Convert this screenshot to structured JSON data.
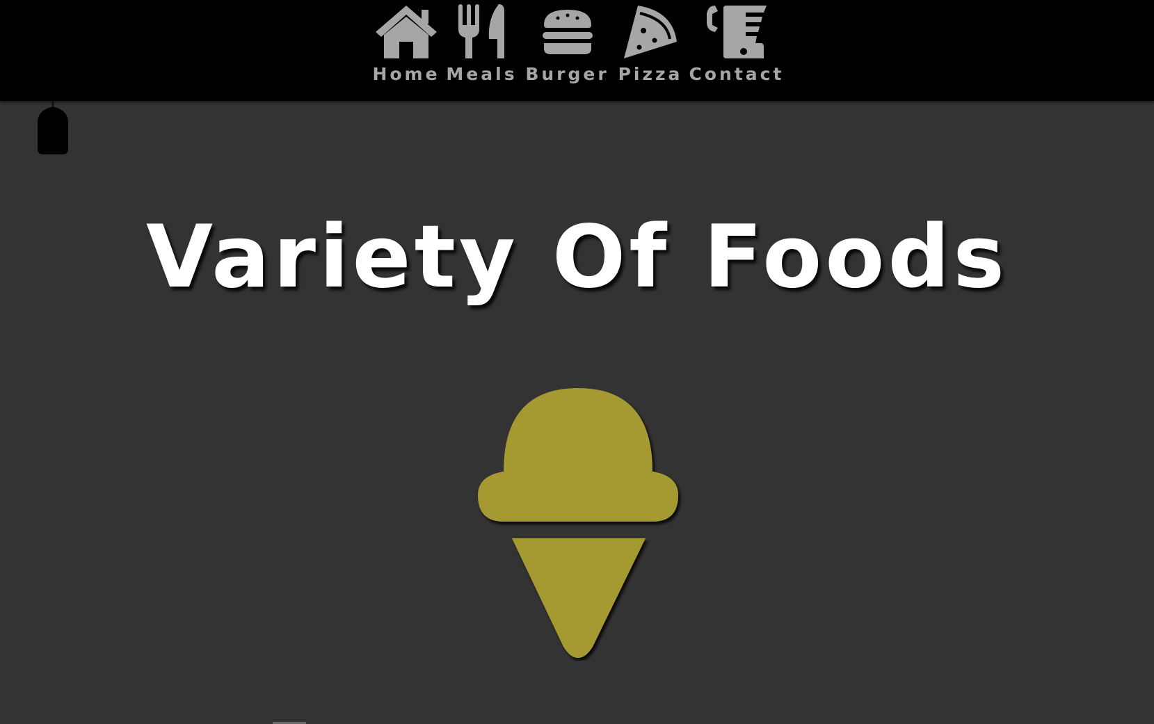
{
  "nav": {
    "items": [
      {
        "label": "Home",
        "icon": "home-icon"
      },
      {
        "label": "Meals",
        "icon": "utensils-icon"
      },
      {
        "label": "Burger",
        "icon": "burger-icon"
      },
      {
        "label": "Pizza",
        "icon": "pizza-icon"
      },
      {
        "label": "Contact",
        "icon": "phone-icon"
      }
    ]
  },
  "hero": {
    "title": "Variety Of Foods",
    "icon": "ice-cream-icon"
  },
  "colors": {
    "nav_background": "#000000",
    "nav_icon": "#a6a6a6",
    "page_background": "#333333",
    "title": "#ffffff",
    "accent": "#a59a30"
  }
}
